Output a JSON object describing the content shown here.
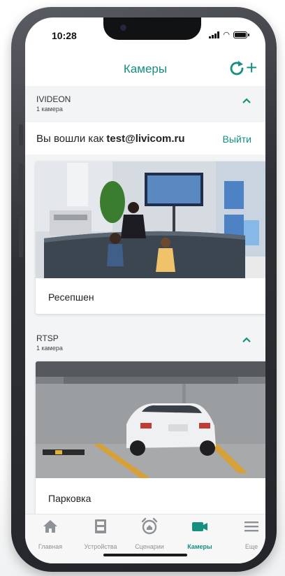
{
  "status_bar": {
    "time": "10:28"
  },
  "header": {
    "title": "Камеры",
    "refresh_icon": "refresh-icon",
    "add_icon": "plus-icon"
  },
  "sections": [
    {
      "name": "IVIDEON",
      "count": "1 камера",
      "login": {
        "prefix": "Вы вошли как ",
        "email": "test@livicom.ru",
        "logout": "Выйти"
      },
      "cameras": [
        {
          "label": "Ресепшен"
        }
      ]
    },
    {
      "name": "RTSP",
      "count": "1 камера",
      "cameras": [
        {
          "label": "Парковка"
        }
      ]
    }
  ],
  "nav": [
    {
      "label": "Главная",
      "icon": "home-icon"
    },
    {
      "label": "Устройства",
      "icon": "devices-icon"
    },
    {
      "label": "Сценарии",
      "icon": "alarm-clock-icon"
    },
    {
      "label": "Камеры",
      "icon": "camera-icon",
      "active": true
    },
    {
      "label": "Еще",
      "icon": "menu-icon"
    }
  ],
  "colors": {
    "accent": "#148f80",
    "inactive": "#8e9196",
    "background": "#f3f4f5"
  }
}
